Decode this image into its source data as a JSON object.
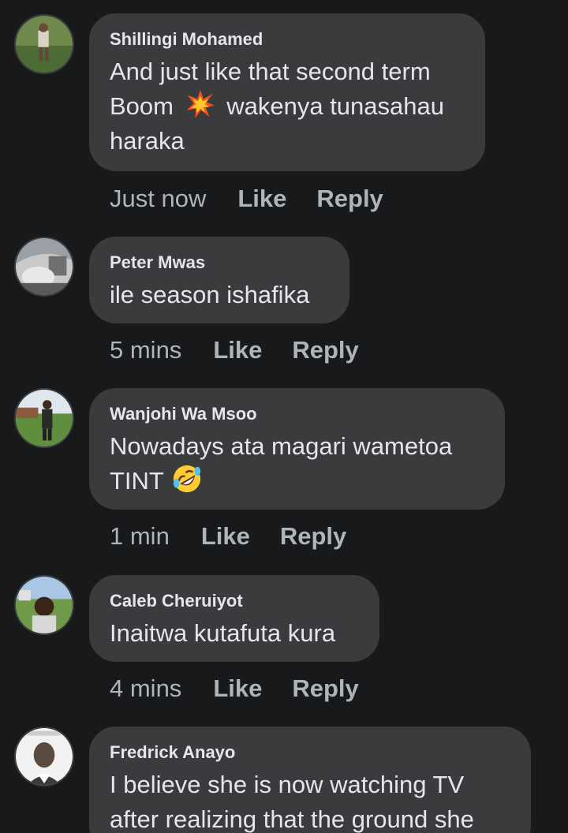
{
  "comments": [
    {
      "author": "Shillingi Mohamed",
      "text_line1": "And just like that second term",
      "text_line2_before": "Boom",
      "text_line2_after": "wakenya tunasahau",
      "text_line3": "haraka",
      "emoji": "collision-emoji",
      "time": "Just now",
      "like_label": "Like",
      "reply_label": "Reply"
    },
    {
      "author": "Peter Mwas",
      "text": "ile season ishafika",
      "time": "5 mins",
      "like_label": "Like",
      "reply_label": "Reply"
    },
    {
      "author": "Wanjohi Wa Msoo",
      "text_line1": "Nowadays ata magari wametoa",
      "text_line2_before": "TINT",
      "emoji": "rolling-laughing-emoji",
      "time": "1 min",
      "like_label": "Like",
      "reply_label": "Reply"
    },
    {
      "author": "Caleb Cheruiyot",
      "text": "Inaitwa kutafuta kura",
      "time": "4 mins",
      "like_label": "Like",
      "reply_label": "Reply"
    },
    {
      "author": "Fredrick Anayo",
      "text_line1": "I believe she is now watching TV",
      "text_line2": "after realizing that the ground she"
    }
  ],
  "colors": {
    "background": "#18191a",
    "bubble": "#3a3b3c",
    "text": "#e4e6eb",
    "secondary_text": "#b0b3b8"
  }
}
